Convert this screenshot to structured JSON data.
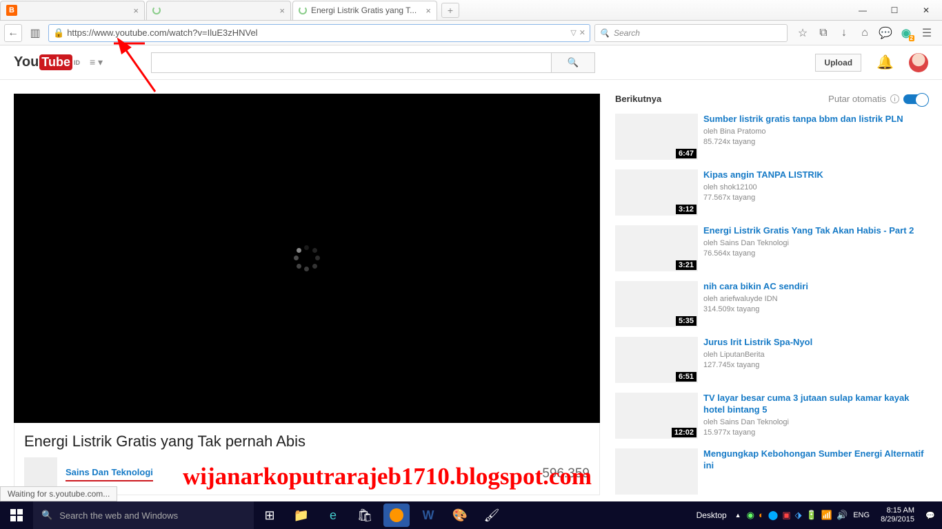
{
  "tabs": [
    {
      "title": "",
      "favicon": "blogger"
    },
    {
      "title": "",
      "favicon": "spinner"
    },
    {
      "title": "Energi Listrik Gratis yang T...",
      "favicon": "spinner",
      "active": true
    }
  ],
  "url": "https://www.youtube.com/watch?v=IluE3zHNVel",
  "search_placeholder": "Search",
  "yt": {
    "country": "ID",
    "upload": "Upload"
  },
  "video": {
    "title": "Energi Listrik Gratis yang Tak pernah Abis",
    "channel": "Sains Dan Teknologi",
    "views": "596.359"
  },
  "sidebar": {
    "next": "Berikutnya",
    "autoplay": "Putar otomatis",
    "items": [
      {
        "title": "Sumber listrik gratis tanpa bbm dan listrik PLN",
        "author": "oleh Bina Pratomo",
        "views": "85.724x tayang",
        "dur": "6:47"
      },
      {
        "title": "Kipas angin TANPA LISTRIK",
        "author": "oleh shok12100",
        "views": "77.567x tayang",
        "dur": "3:12"
      },
      {
        "title": "Energi Listrik Gratis Yang Tak Akan Habis - Part 2",
        "author": "oleh Sains Dan Teknologi",
        "views": "76.564x tayang",
        "dur": "3:21"
      },
      {
        "title": "nih cara bikin AC sendiri",
        "author": "oleh ariefwaluyde IDN",
        "views": "314.509x tayang",
        "dur": "5:35"
      },
      {
        "title": "Jurus Irit Listrik Spa-Nyol",
        "author": "oleh LiputanBerita",
        "views": "127.745x tayang",
        "dur": "6:51"
      },
      {
        "title": "TV layar besar cuma 3 jutaan sulap kamar kayak hotel bintang 5",
        "author": "oleh Sains Dan Teknologi",
        "views": "15.977x tayang",
        "dur": "12:02"
      },
      {
        "title": "Mengungkap Kebohongan Sumber Energi Alternatif ini",
        "author": "",
        "views": "",
        "dur": ""
      }
    ]
  },
  "status": "Waiting for s.youtube.com...",
  "watermark": "wijanarkoputrarajeb1710.blogspot.com",
  "taskbar": {
    "search": "Search the web and Windows",
    "desktop": "Desktop",
    "lang": "ENG",
    "time": "8:15 AM",
    "date": "8/29/2015"
  }
}
